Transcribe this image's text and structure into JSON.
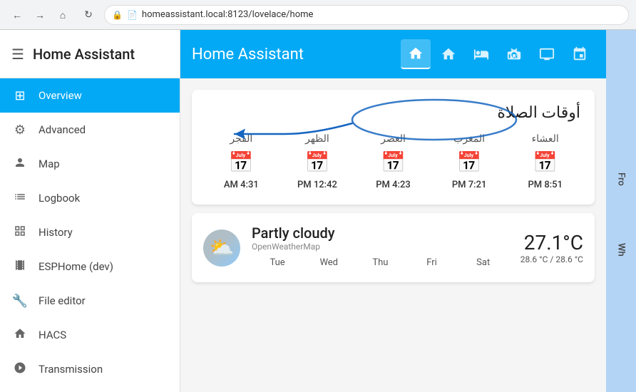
{
  "browser": {
    "back_title": "Back",
    "forward_title": "Forward",
    "refresh_title": "Refresh",
    "home_title": "Home",
    "url": "homeassistant.local:8123/lovelace/home"
  },
  "sidebar": {
    "hamburger_label": "☰",
    "title": "Home Assistant",
    "items": [
      {
        "id": "overview",
        "label": "Overview",
        "icon": "⊞",
        "active": true
      },
      {
        "id": "advanced",
        "label": "Advanced",
        "icon": "⚙"
      },
      {
        "id": "map",
        "label": "Map",
        "icon": "👤"
      },
      {
        "id": "logbook",
        "label": "Logbook",
        "icon": "☰"
      },
      {
        "id": "history",
        "label": "History",
        "icon": "📊"
      },
      {
        "id": "esphome",
        "label": "ESPHome (dev)",
        "icon": "🎞"
      },
      {
        "id": "file-editor",
        "label": "File editor",
        "icon": "🔧"
      },
      {
        "id": "hacs",
        "label": "HACS",
        "icon": "🏠"
      },
      {
        "id": "transmission",
        "label": "Transmission",
        "icon": "🕐"
      }
    ]
  },
  "header": {
    "title": "Home Assistant",
    "tabs": [
      {
        "id": "home",
        "icon": "⌂",
        "active": true
      },
      {
        "id": "person",
        "icon": "🏠"
      },
      {
        "id": "house",
        "icon": "🏠"
      },
      {
        "id": "sofa",
        "icon": "🛋"
      },
      {
        "id": "screen",
        "icon": "🖥"
      },
      {
        "id": "network",
        "icon": "⬛"
      }
    ]
  },
  "prayer_card": {
    "title": "أوقات الصلاة",
    "prayers": [
      {
        "name": "الفجر",
        "time": "4:31 AM"
      },
      {
        "name": "الظهر",
        "time": "12:42 PM"
      },
      {
        "name": "العصر",
        "time": "4:23 PM"
      },
      {
        "name": "المغرب",
        "time": "7:21 PM"
      },
      {
        "name": "العشاء",
        "time": "8:51 PM"
      }
    ]
  },
  "weather_card": {
    "condition": "Partly cloudy",
    "source": "OpenWeatherMap",
    "temperature": "27.1°C",
    "range": "28.6 °C / 28.6 °C",
    "days": [
      "Tue",
      "Wed",
      "Thu",
      "Fri",
      "Sat"
    ]
  },
  "right_panel": {
    "label_fro": "Fro",
    "label_wh": "Wh"
  }
}
